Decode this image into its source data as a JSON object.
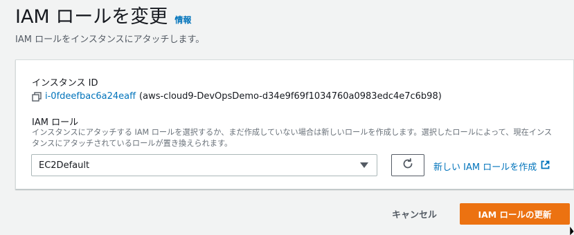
{
  "header": {
    "title": "IAM ロールを変更",
    "info_link": "情報",
    "description": "IAM ロールをインスタンスにアタッチします。"
  },
  "instance": {
    "label": "インスタンス ID",
    "id": "i-0fdeefbac6a24eaff",
    "name": "(aws-cloud9-DevOpsDemo-d34e9f69f1034760a0983edc4e7c6b98)"
  },
  "iam_role": {
    "label": "IAM ロール",
    "description": "インスタンスにアタッチする IAM ロールを選択するか、まだ作成していない場合は新しいロールを作成します。選択したロールによって、現在インスタンスにアタッチされているロールが置き換えられます。",
    "selected_value": "EC2Default",
    "create_link": "新しい IAM ロールを作成"
  },
  "actions": {
    "cancel_label": "キャンセル",
    "update_label": "IAM ロールの更新"
  },
  "colors": {
    "link": "#0073bb",
    "primary_button": "#ec7211",
    "background": "#f2f3f3"
  },
  "icons": [
    "copy-icon",
    "caret-down-icon",
    "refresh-icon",
    "external-link-icon"
  ]
}
